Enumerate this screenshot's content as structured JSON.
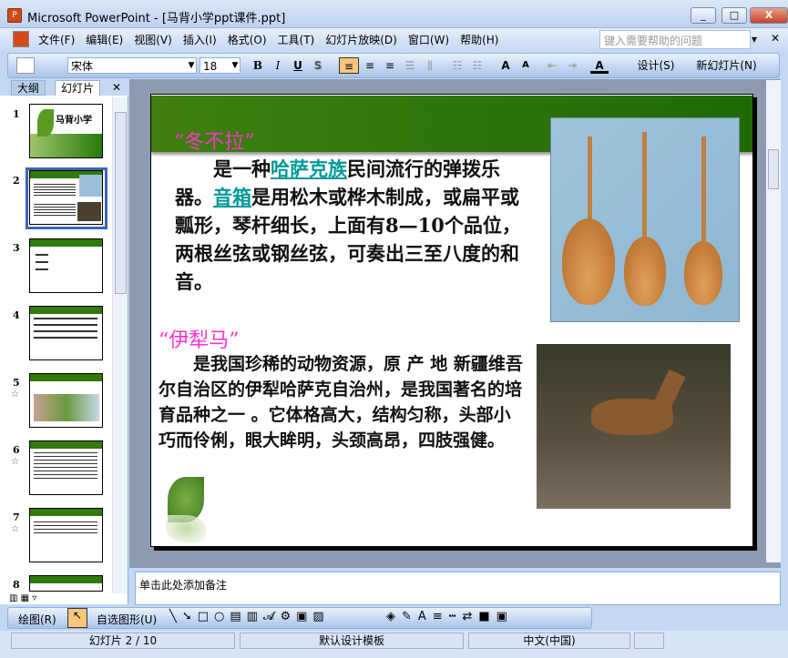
{
  "window": {
    "title": "Microsoft PowerPoint - [马背小学ppt课件.ppt]",
    "app_icon": "P"
  },
  "menu": [
    "文件(F)",
    "编辑(E)",
    "视图(V)",
    "插入(I)",
    "格式(O)",
    "工具(T)",
    "幻灯片放映(D)",
    "窗口(W)",
    "帮助(H)"
  ],
  "help_placeholder": "键入需要帮助的问题",
  "toolbar": {
    "font": "宋体",
    "size": "18",
    "bold": "B",
    "italic": "I",
    "underline": "U",
    "shadow": "S",
    "design": "设计(S)",
    "new_slide": "新幻灯片(N)"
  },
  "left_tabs": {
    "outline": "大纲",
    "slides": "幻灯片"
  },
  "thumbnails": [
    {
      "num": "1",
      "title": "马背小学"
    },
    {
      "num": "2"
    },
    {
      "num": "3"
    },
    {
      "num": "4"
    },
    {
      "num": "5"
    },
    {
      "num": "6"
    },
    {
      "num": "7"
    },
    {
      "num": "8"
    }
  ],
  "star": "☆",
  "slide": {
    "heading1": "“冬不拉”",
    "para1": [
      {
        "t": "　　是一种"
      },
      {
        "t": "哈萨克族",
        "link": true
      },
      {
        "t": "民间流行的弹拨乐器。"
      },
      {
        "t": "音箱",
        "link": true
      },
      {
        "t": "是用松木或桦木制成，或扁平或瓢形，琴杆细长，上面有8—10个品位，两根丝弦或钢丝弦，可奏出三至八度的和音。"
      }
    ],
    "heading2": "“伊犁马”",
    "para2": "　　是我国珍稀的动物资源，原 产 地 新疆维吾尔自治区的伊犁哈萨克自治州，是我国著名的培育品种之一 。它体格高大，结构匀称，头部小巧而伶俐，眼大眸明，头颈高昂，四肢强健。"
  },
  "notes_placeholder": "单击此处添加备注",
  "drawbar": {
    "draw": "绘图(R)",
    "autoshapes": "自选图形(U)"
  },
  "status": {
    "slide": "幻灯片 2 / 10",
    "template": "默认设计模板",
    "language": "中文(中国)"
  }
}
